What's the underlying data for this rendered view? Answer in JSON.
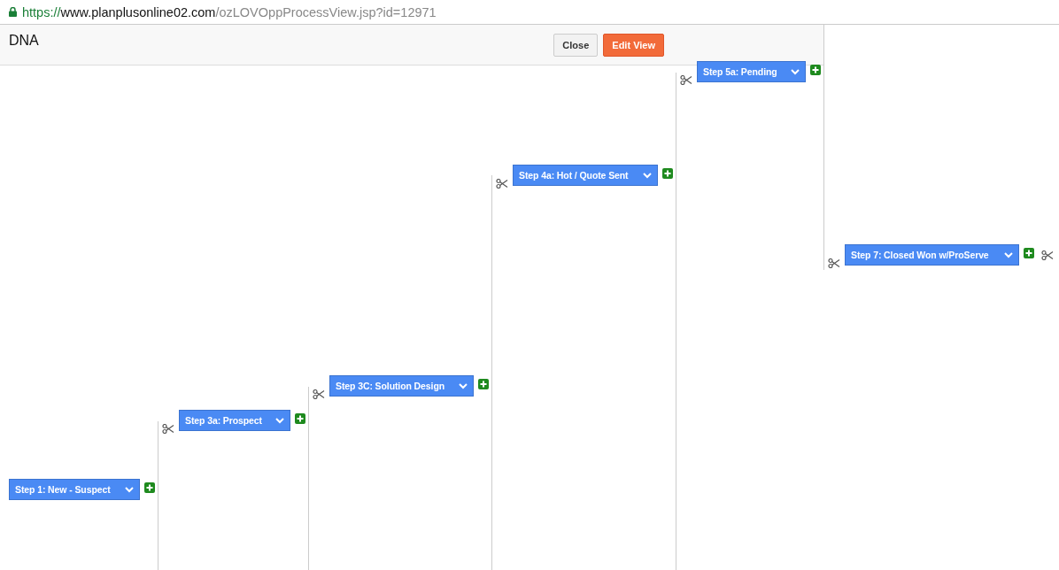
{
  "address_bar": {
    "scheme": "https://",
    "host": "www.planplusonline02.com",
    "path": "/ozLOVOppProcessView.jsp?id=12971"
  },
  "header": {
    "title": "DNA",
    "buttons": [
      {
        "label": "Close",
        "kind": "default"
      },
      {
        "label": "Edit View",
        "kind": "primary"
      }
    ]
  },
  "stages": [
    {
      "label": "Step 1: New - Suspect",
      "trailing_cut": false
    },
    {
      "label": "Step 3a: Prospect",
      "trailing_cut": false
    },
    {
      "label": "Step 3C: Solution Design",
      "trailing_cut": false
    },
    {
      "label": "Step 4a: Hot / Quote Sent",
      "trailing_cut": false
    },
    {
      "label": "Step 5a: Pending",
      "trailing_cut": false
    },
    {
      "label": "Step 7: Closed Won w/ProServe",
      "trailing_cut": true
    }
  ]
}
